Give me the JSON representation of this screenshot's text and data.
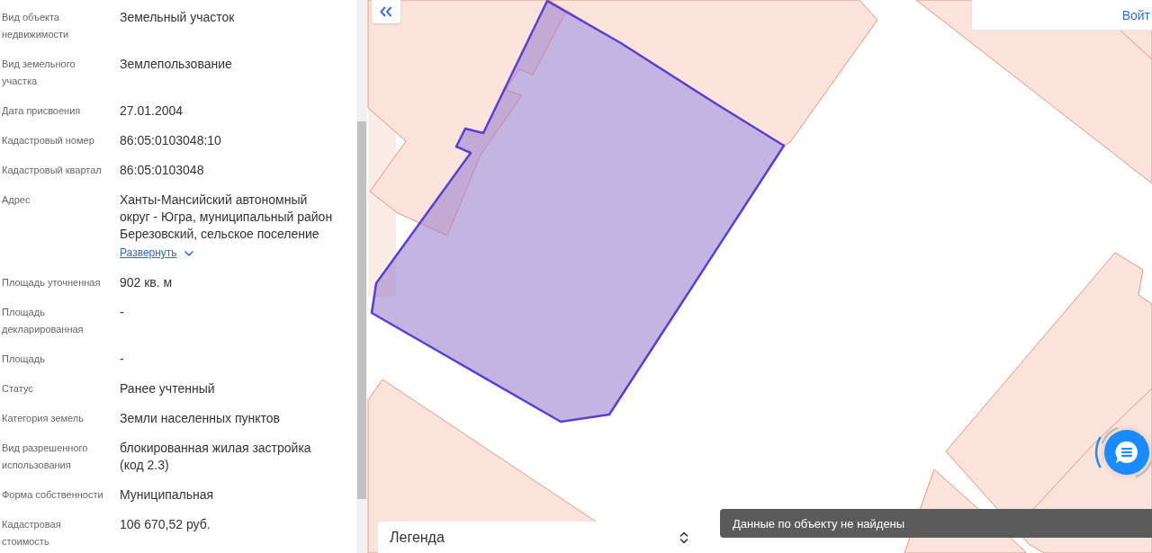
{
  "sidebar": {
    "fields": [
      {
        "label": "Вид объекта недвижимости",
        "value": "Земельный участок"
      },
      {
        "label": "Вид земельного участка",
        "value": "Землепользование"
      },
      {
        "label": "Дата присвоения",
        "value": "27.01.2004"
      },
      {
        "label": "Кадастровый номер",
        "value": "86:05:0103048:10"
      },
      {
        "label": "Кадастровый квартал",
        "value": "86:05:0103048"
      },
      {
        "label": "Адрес",
        "value": "Ханты-Мансийский автономный округ - Югра, муниципальный район Березовский, сельское поселение",
        "expand_link": "Развернуть"
      },
      {
        "label": "Площадь уточненная",
        "value": "902 кв. м"
      },
      {
        "label": "Площадь декларированная",
        "value": "-"
      },
      {
        "label": "Площадь",
        "value": "-"
      },
      {
        "label": "Статус",
        "value": "Ранее учтенный"
      },
      {
        "label": "Категория земель",
        "value": "Земли населенных пунктов"
      },
      {
        "label": "Вид разрешенного использования",
        "value": "блокированная жилая застройка (код 2.3)"
      },
      {
        "label": "Форма собственности",
        "value": "Муниципальная"
      },
      {
        "label": "Кадастровая стоимость",
        "value": "106 670,52 руб."
      }
    ]
  },
  "map": {
    "login_button": "Войт",
    "legend": {
      "title": "Легенда"
    },
    "toast": "Данные по объекту не найдены"
  }
}
